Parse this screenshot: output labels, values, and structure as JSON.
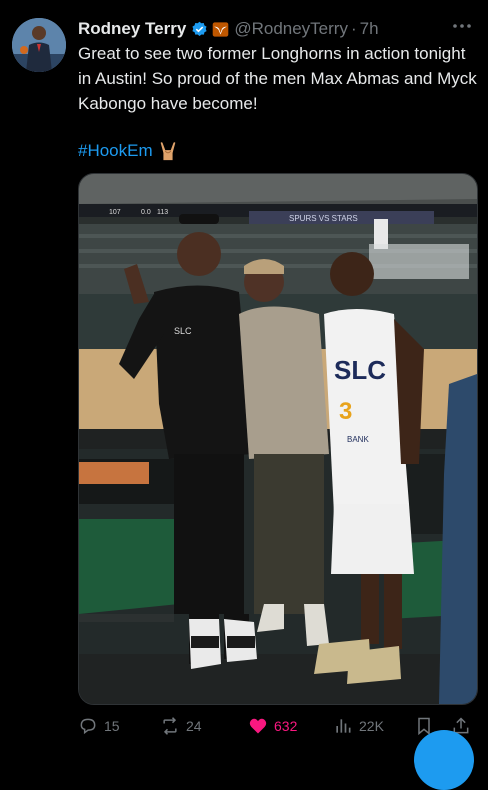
{
  "tweet": {
    "author_name": "Rodney Terry",
    "handle": "@RodneyTerry",
    "separator": "·",
    "time": "7h",
    "text": "Great to see two former Longhorns in action tonight in Austin! So proud of the men Max Abmas and Myck Kabongo have become!",
    "hashtag": "#HookEm"
  },
  "scoreboard": {
    "left_score": "107",
    "quarter": "0.0",
    "right_score": "113",
    "banner": "SPURS VS STARS"
  },
  "jersey": {
    "team": "SLC",
    "number": "3",
    "sponsor": "BANK"
  },
  "shirt_logo": "SLC",
  "actions": {
    "replies": "15",
    "retweets": "24",
    "likes": "632",
    "views": "22K"
  },
  "colors": {
    "accent": "#1d9bf0",
    "like": "#f91880",
    "muted": "#71767b",
    "background": "#000000"
  },
  "icons": [
    "verified-icon",
    "texas-longhorns-icon",
    "more-icon",
    "hook-em-horns-icon",
    "reply-icon",
    "retweet-icon",
    "like-icon",
    "views-icon",
    "bookmark-icon",
    "share-icon"
  ]
}
